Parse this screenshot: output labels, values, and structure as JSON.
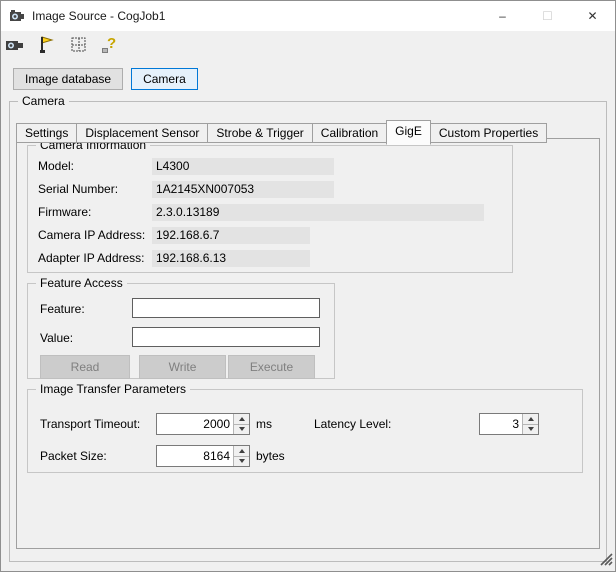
{
  "window": {
    "title": "Image Source - CogJob1",
    "minimize_glyph": "–",
    "maximize_glyph": "☐",
    "close_glyph": "✕"
  },
  "toolbar": {
    "icons": [
      {
        "name": "camera-icon"
      },
      {
        "name": "pointer-flag-icon"
      },
      {
        "name": "grid-icon"
      },
      {
        "name": "help-icon"
      }
    ],
    "help_glyph": "?"
  },
  "source_buttons": {
    "image_database_label": "Image database",
    "camera_label": "Camera"
  },
  "camera_group": {
    "label": "Camera",
    "tabs": [
      {
        "label": "Settings",
        "active": false
      },
      {
        "label": "Displacement Sensor",
        "active": false
      },
      {
        "label": "Strobe & Trigger",
        "active": false
      },
      {
        "label": "Calibration",
        "active": false
      },
      {
        "label": "GigE",
        "active": true
      },
      {
        "label": "Custom Properties",
        "active": false
      }
    ],
    "camera_information": {
      "label": "Camera Information",
      "fields": [
        {
          "label": "Model:",
          "value": "L4300"
        },
        {
          "label": "Serial Number:",
          "value": "1A2145XN007053"
        },
        {
          "label": "Firmware:",
          "value": "2.3.0.13189"
        },
        {
          "label": "Camera IP Address:",
          "value": "192.168.6.7"
        },
        {
          "label": "Adapter IP Address:",
          "value": "192.168.6.13"
        }
      ]
    },
    "feature_access": {
      "label": "Feature Access",
      "feature_label": "Feature:",
      "feature_value": "",
      "value_label": "Value:",
      "value_value": "",
      "read_label": "Read",
      "write_label": "Write",
      "execute_label": "Execute"
    },
    "image_transfer": {
      "label": "Image Transfer Parameters",
      "transport_timeout_label": "Transport Timeout:",
      "transport_timeout_value": "2000",
      "transport_timeout_unit": "ms",
      "latency_level_label": "Latency Level:",
      "latency_level_value": "3",
      "packet_size_label": "Packet Size:",
      "packet_size_value": "8164",
      "packet_size_unit": "bytes"
    }
  }
}
